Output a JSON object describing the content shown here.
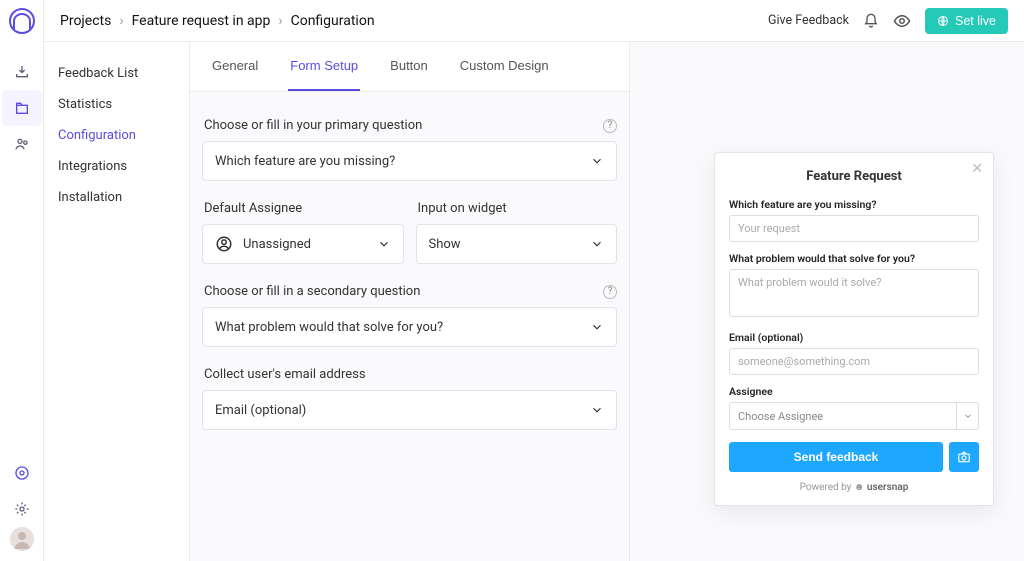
{
  "breadcrumbs": [
    "Projects",
    "Feature request in app",
    "Configuration"
  ],
  "top": {
    "feedback": "Give Feedback",
    "set_live": "Set live"
  },
  "sidebar": {
    "items": [
      {
        "label": "Feedback List"
      },
      {
        "label": "Statistics"
      },
      {
        "label": "Configuration"
      },
      {
        "label": "Integrations"
      },
      {
        "label": "Installation"
      }
    ]
  },
  "tabs": [
    "General",
    "Form Setup",
    "Button",
    "Custom Design"
  ],
  "form": {
    "primary_label": "Choose or fill in your primary question",
    "primary_value": "Which feature are you missing?",
    "assignee_label": "Default Assignee",
    "assignee_value": "Unassigned",
    "input_widget_label": "Input on widget",
    "input_widget_value": "Show",
    "secondary_label": "Choose or fill in a secondary question",
    "secondary_value": "What problem would that solve for you?",
    "email_label": "Collect user's email address",
    "email_value": "Email (optional)"
  },
  "widget": {
    "title": "Feature Request",
    "q1_label": "Which feature are you missing?",
    "q1_placeholder": "Your request",
    "q2_label": "What problem would that solve for you?",
    "q2_placeholder": "What problem would it solve?",
    "email_label": "Email (optional)",
    "email_placeholder": "someone@something.com",
    "assignee_label": "Assignee",
    "assignee_placeholder": "Choose Assignee",
    "send": "Send feedback",
    "powered_prefix": "Powered by ",
    "powered_brand": "usersnap"
  }
}
